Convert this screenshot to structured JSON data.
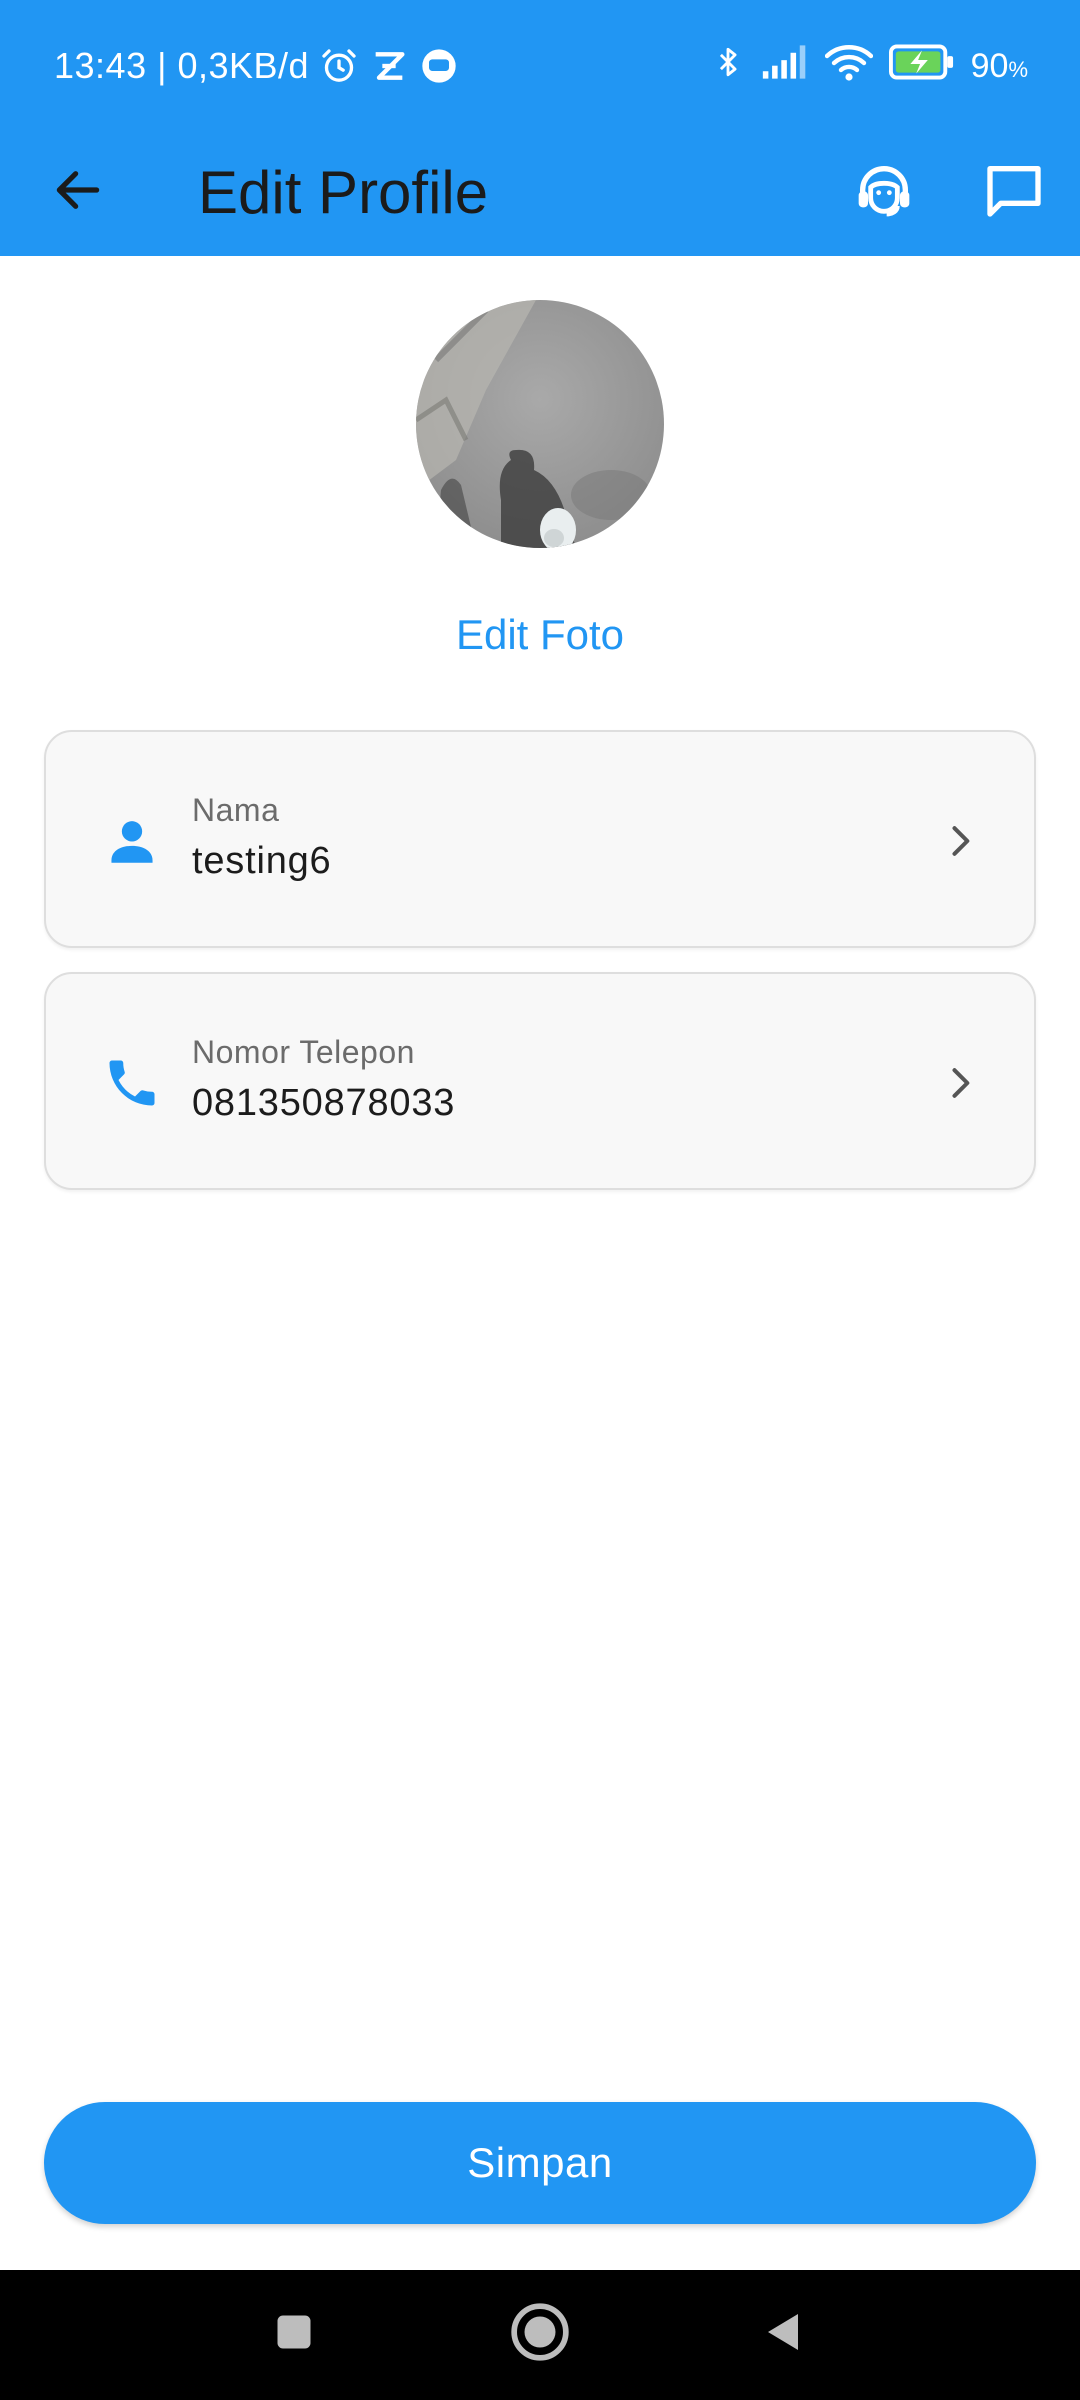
{
  "status_bar": {
    "time_speed": "13:43 | 0,3KB/d",
    "battery_percent": "90",
    "battery_unit": "%",
    "icons": [
      "alarm-icon",
      "app-notification-icon",
      "message-notification-icon",
      "bluetooth-icon",
      "signal-icon",
      "wifi-icon",
      "battery-charging-icon"
    ]
  },
  "app_bar": {
    "title": "Edit Profile",
    "back_icon": "arrow-back-icon",
    "actions": [
      "headset-support-icon",
      "chat-icon"
    ]
  },
  "profile": {
    "edit_photo_label": "Edit Foto"
  },
  "fields": [
    {
      "label": "Nama",
      "value": "testing6",
      "icon": "person-icon"
    },
    {
      "label": "Nomor Telepon",
      "value": "081350878033",
      "icon": "phone-icon"
    }
  ],
  "save_button": {
    "label": "Simpan"
  },
  "colors": {
    "primary": "#2196f3",
    "card_bg": "#f8f8f8",
    "card_border": "#dedede"
  }
}
